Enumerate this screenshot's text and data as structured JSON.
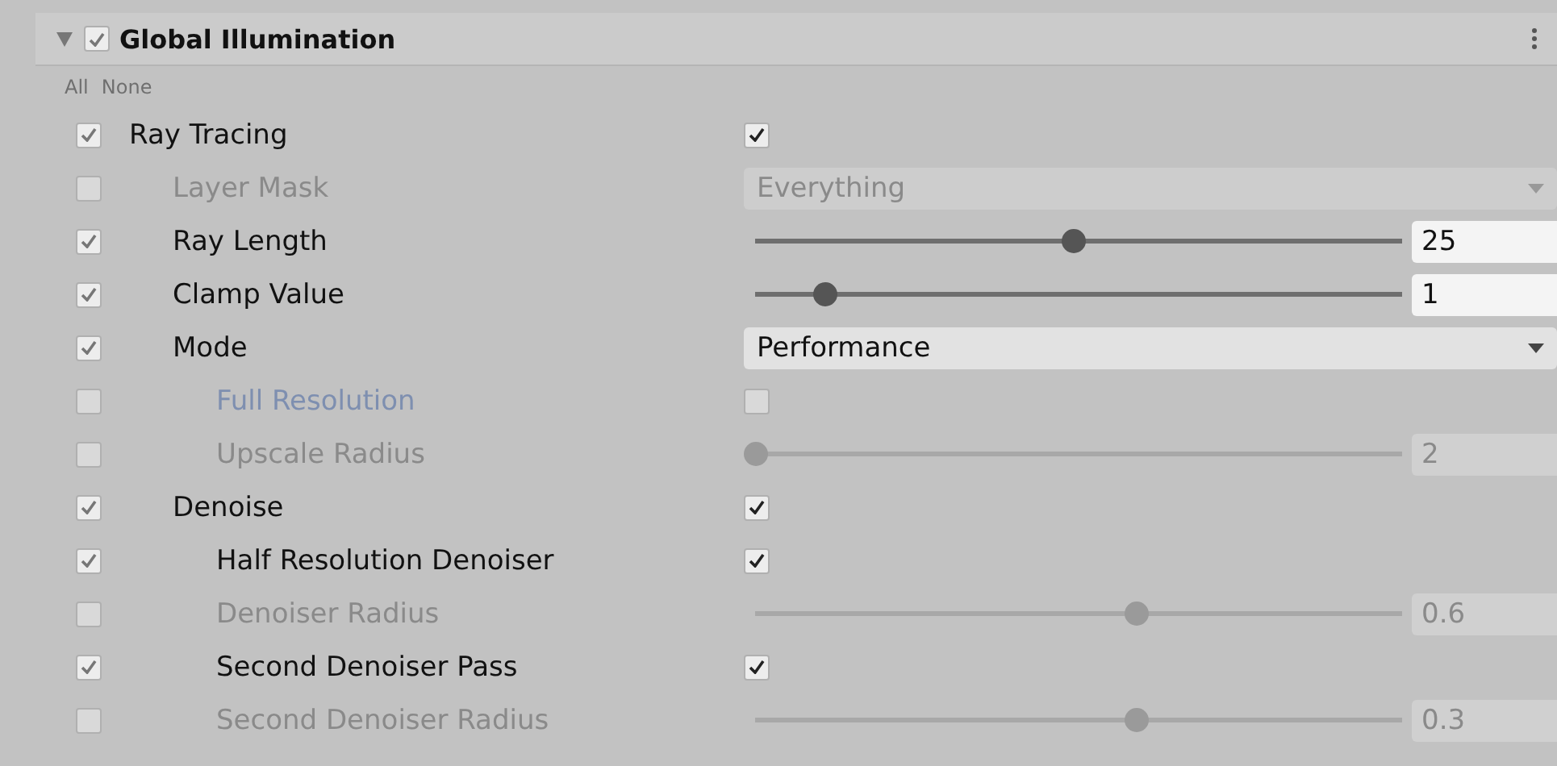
{
  "header": {
    "title": "Global Illumination",
    "expanded": true,
    "checked": true
  },
  "toggles": [
    "All",
    "None"
  ],
  "settings": [
    {
      "label": "Ray Tracing",
      "override": true,
      "highlighted": false,
      "kind": "toggle",
      "checked": true,
      "children": [
        {
          "label": "Layer Mask",
          "override": false,
          "highlighted": false,
          "kind": "dropdown",
          "value": "Everything"
        },
        {
          "label": "Ray Length",
          "override": true,
          "highlighted": false,
          "kind": "slider",
          "level": 0.5,
          "value": "25"
        },
        {
          "label": "Clamp Value",
          "override": true,
          "highlighted": false,
          "kind": "slider",
          "level": 0.11,
          "value": "1"
        },
        {
          "label": "Mode",
          "override": true,
          "highlighted": false,
          "kind": "dropdown",
          "value": "Performance",
          "children": [
            {
              "label": "Full Resolution",
              "override": false,
              "highlighted": true,
              "kind": "toggle",
              "checked": false
            },
            {
              "label": "Upscale Radius",
              "override": false,
              "highlighted": false,
              "kind": "slider",
              "level": 0,
              "value": "2"
            }
          ]
        },
        {
          "label": "Denoise",
          "override": true,
          "highlighted": false,
          "kind": "toggle",
          "checked": true,
          "children": [
            {
              "label": "Half Resolution Denoiser",
              "override": true,
              "highlighted": false,
              "kind": "toggle",
              "checked": true
            },
            {
              "label": "Denoiser Radius",
              "override": false,
              "highlighted": false,
              "kind": "slider",
              "level": 0.6,
              "value": "0.6"
            },
            {
              "label": "Second Denoiser Pass",
              "override": true,
              "highlighted": false,
              "kind": "toggle",
              "checked": true
            },
            {
              "label": "Second Denoiser Radius",
              "override": false,
              "highlighted": false,
              "kind": "slider",
              "level": 0.6,
              "value": "0.3"
            }
          ]
        }
      ]
    }
  ]
}
